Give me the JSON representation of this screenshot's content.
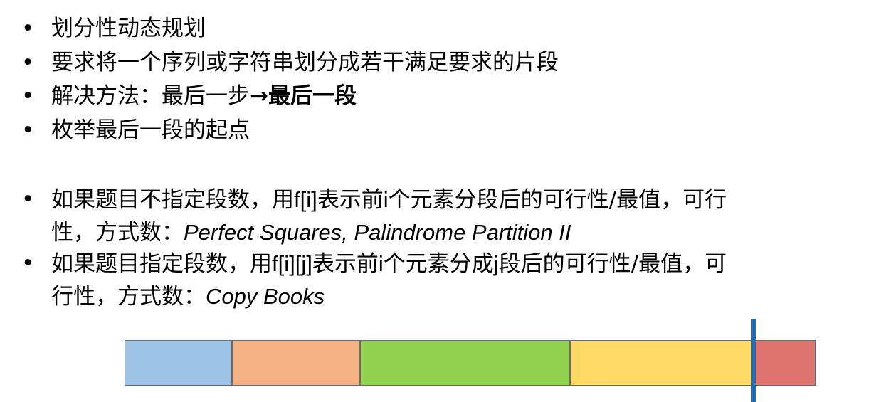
{
  "bullets": [
    {
      "dot": "•",
      "text": "划分性动态规划"
    },
    {
      "dot": "•",
      "text": "要求将一个序列或字符串划分成若干满足要求的片段"
    },
    {
      "dot": "•",
      "text_before": "解决方法：最后一步",
      "arrow": "→",
      "text_bold": "最后一段"
    },
    {
      "dot": "•",
      "text": "枚举最后一段的起点"
    },
    {
      "dot": "•",
      "line1_a": "如果题目不指定段数，用",
      "line1_b": "f[i]",
      "line1_c": "表示前",
      "line1_d": "i",
      "line1_e": "个元素分段后的可行性/最值，可行",
      "line2_a": "性，方式数：",
      "line2_b": "Perfect Squares, Palindrome Partition II"
    },
    {
      "dot": "•",
      "line1_a": "如果题目指定段数，用",
      "line1_b": "f[i][j]",
      "line1_c": "表示前",
      "line1_d": "i",
      "line1_e": "个元素分成",
      "line1_f": "j",
      "line1_g": "段后的可行性/最值，可",
      "line2_a": "行性，方式数：",
      "line2_b": "Copy Books"
    }
  ],
  "segments": [
    {
      "name": "segment-1",
      "color": "#9dc3e6",
      "fraction": 0.155
    },
    {
      "name": "segment-2",
      "color": "#f4b183",
      "fraction": 0.185
    },
    {
      "name": "segment-3",
      "color": "#92d050",
      "fraction": 0.304
    },
    {
      "name": "segment-4",
      "color": "#ffd966",
      "fraction": 0.268
    },
    {
      "name": "segment-5",
      "color": "#e07470",
      "fraction": 0.088
    }
  ],
  "marker_color": "#1f6cb5"
}
